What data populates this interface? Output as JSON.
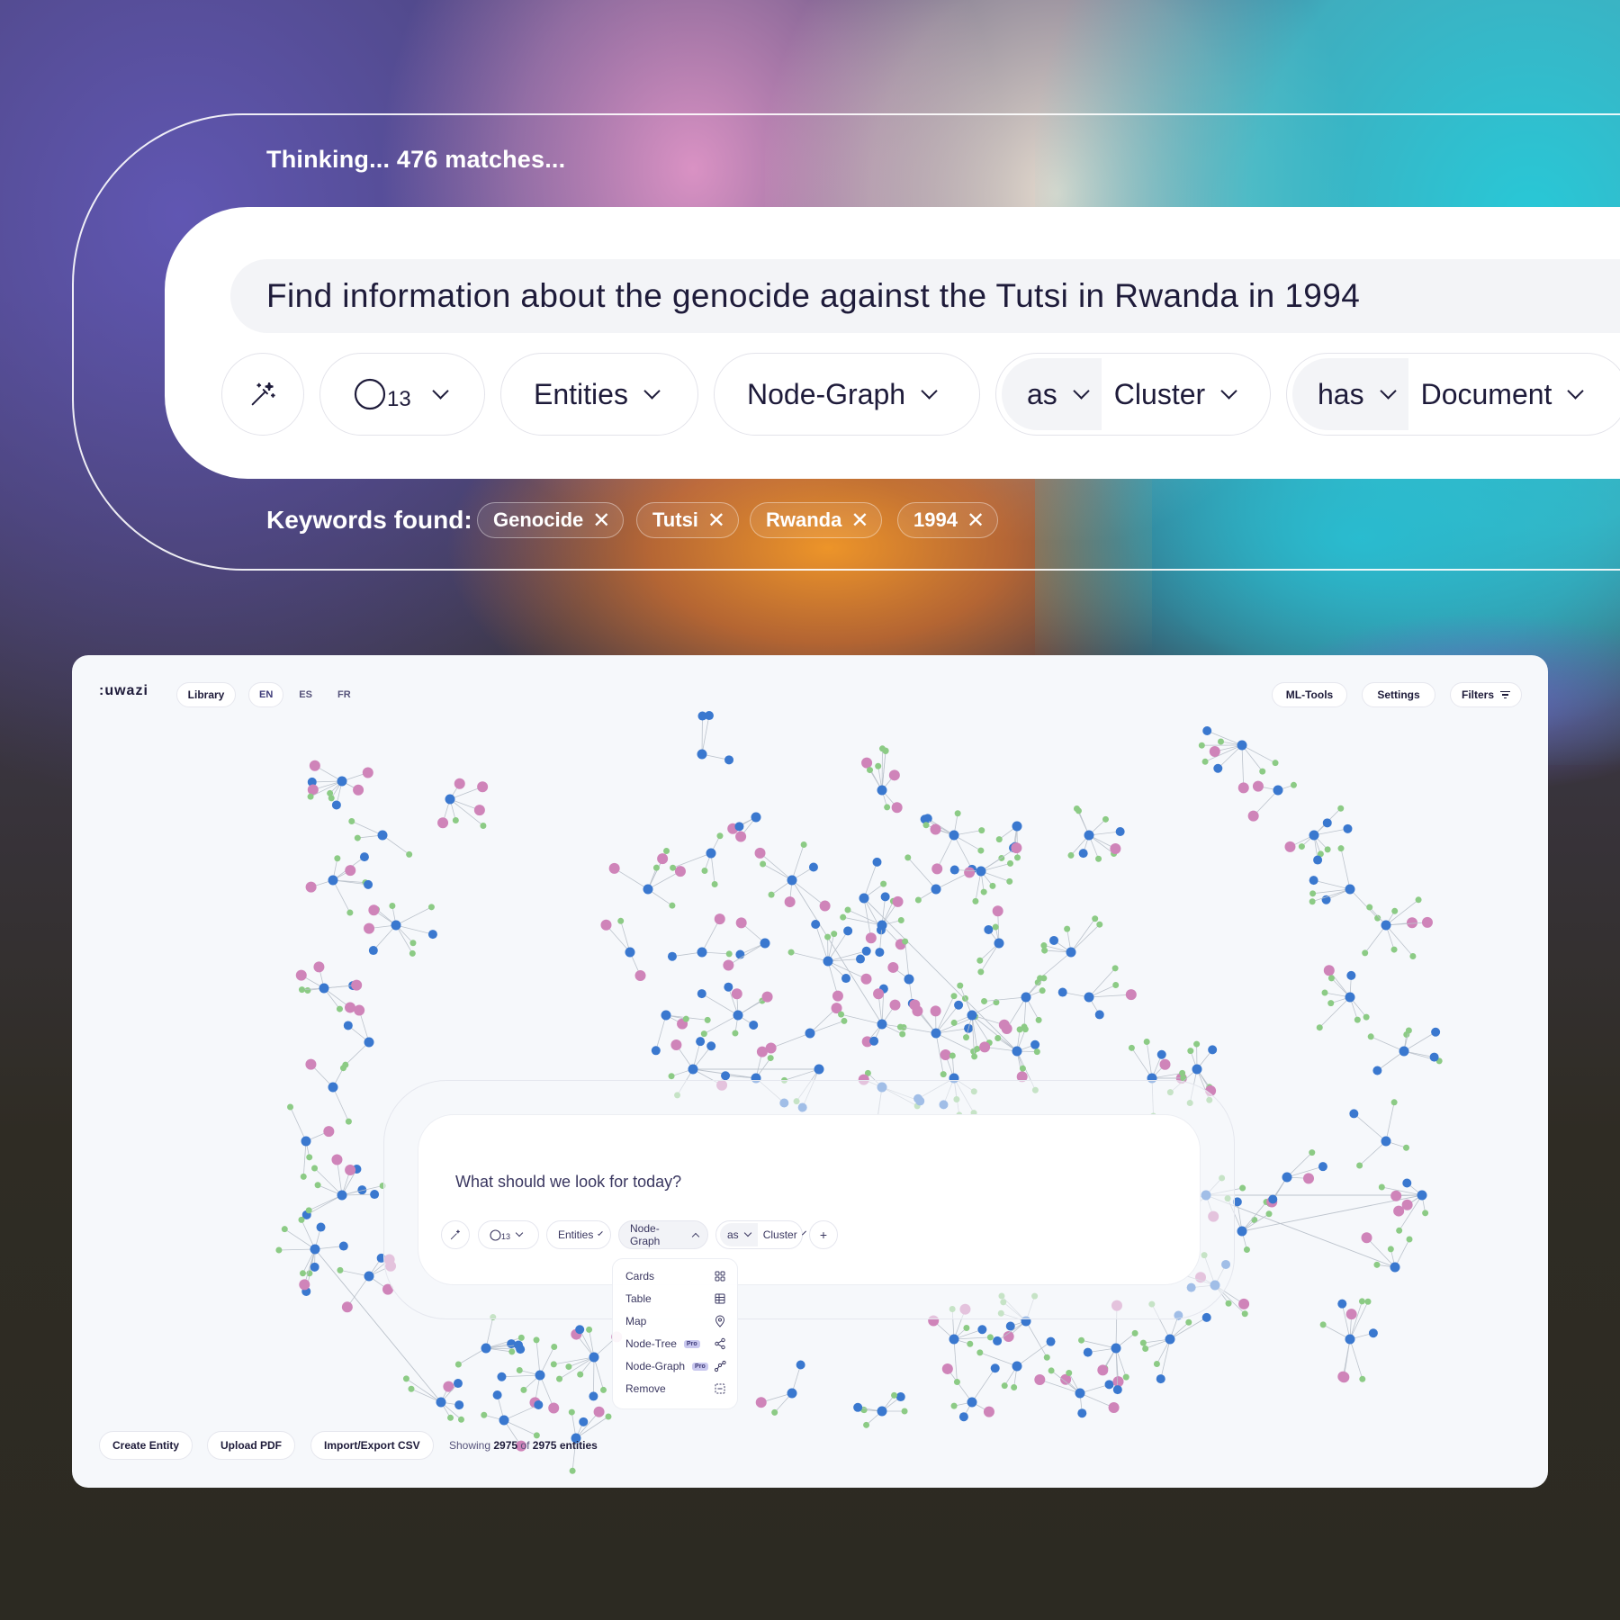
{
  "colors": {
    "accent": "#3d3a78",
    "node_blue": "#3a78cf",
    "node_pink": "#cf84b9",
    "node_green": "#8ccb85",
    "edge": "#bcc3cc"
  },
  "top_search": {
    "status": "Thinking... 476 matches...",
    "query": "Find information about the genocide against the Tutsi in Rwanda in 1994",
    "magic_icon": "magic-wand-icon",
    "depth_icon": "circle-icon",
    "depth_value": "13",
    "entities_label": "Entities",
    "view_label": "Node-Graph",
    "as_label": "as",
    "cluster_label": "Cluster",
    "has_label": "has",
    "document_label": "Document",
    "keywords_label": "Keywords found:",
    "keywords": [
      "Genocide",
      "Tutsi",
      "Rwanda",
      "1994"
    ]
  },
  "app": {
    "logo": ":uwazi",
    "library": "Library",
    "languages": [
      "EN",
      "ES",
      "FR"
    ],
    "active_language": "EN",
    "ml_tools": "ML-Tools",
    "settings": "Settings",
    "filters": "Filters",
    "chat": {
      "placeholder": "What should we look for today?",
      "depth_value": "13",
      "entities_label": "Entities",
      "view_label": "Node-Graph",
      "as_label": "as",
      "cluster_label": "Cluster",
      "add_label": "+"
    },
    "view_menu": [
      {
        "label": "Cards",
        "icon": "grid-icon",
        "pro": false
      },
      {
        "label": "Table",
        "icon": "table-icon",
        "pro": false
      },
      {
        "label": "Map",
        "icon": "map-pin-icon",
        "pro": false
      },
      {
        "label": "Node-Tree",
        "icon": "share-icon",
        "pro": true
      },
      {
        "label": "Node-Graph",
        "icon": "graph-icon",
        "pro": true
      },
      {
        "label": "Remove",
        "icon": "remove-icon",
        "pro": false
      }
    ],
    "pro_badge": "Pro",
    "bottom": {
      "create_entity": "Create Entity",
      "upload_pdf": "Upload PDF",
      "import_export": "Import/Export CSV",
      "showing_prefix": "Showing",
      "showing_count": "2975",
      "showing_of": "of",
      "showing_total": "2975",
      "showing_suffix": "entities"
    }
  }
}
